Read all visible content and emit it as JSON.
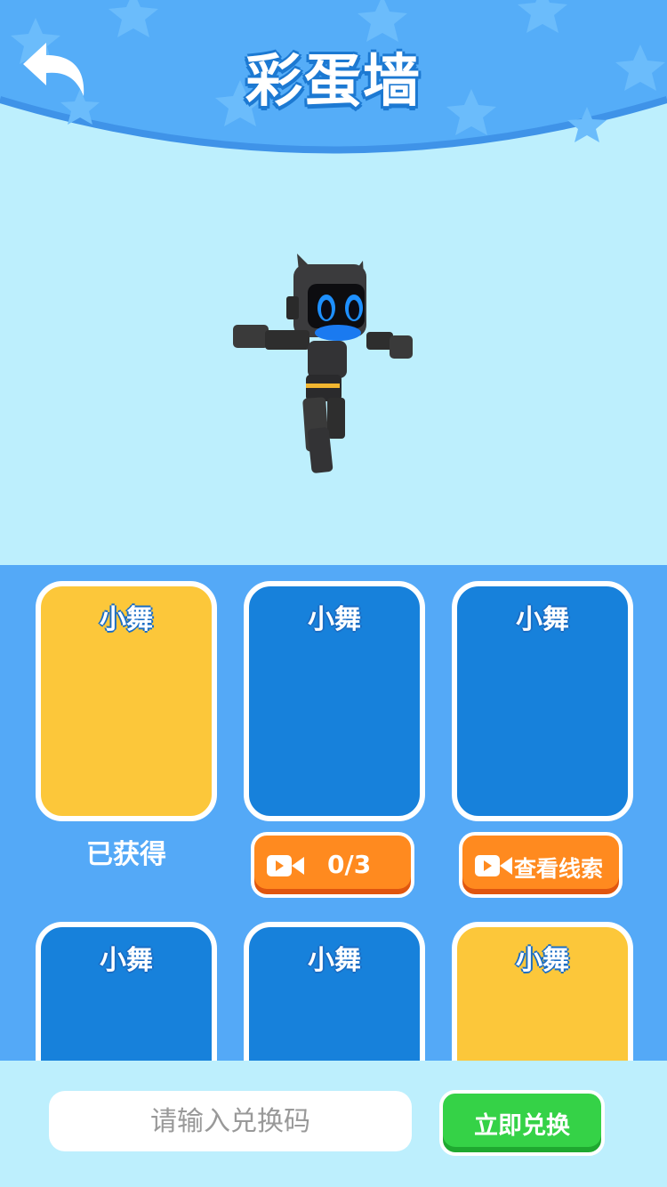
{
  "header": {
    "title": "彩蛋墙",
    "back_icon": "back-arrow-icon"
  },
  "colors": {
    "header_blue": "#55adf8",
    "page_bg": "#bdeffd",
    "panel_bg": "#54a9f7",
    "card_yellow": "#fcc73a",
    "card_blue": "#1781db",
    "orange_button": "#ff8a1f",
    "green_button": "#35d247"
  },
  "cards": [
    {
      "name": "小舞",
      "status": "已获得"
    },
    {
      "name": "小舞",
      "action_label": "0/3",
      "action_icon": "video-camera-icon"
    },
    {
      "name": "小舞",
      "action_label": "查看线索",
      "action_icon": "video-camera-icon"
    },
    {
      "name": "小舞"
    },
    {
      "name": "小舞"
    },
    {
      "name": "小舞"
    }
  ],
  "redeem": {
    "placeholder": "请输入兑换码",
    "button_label": "立即兑换"
  }
}
